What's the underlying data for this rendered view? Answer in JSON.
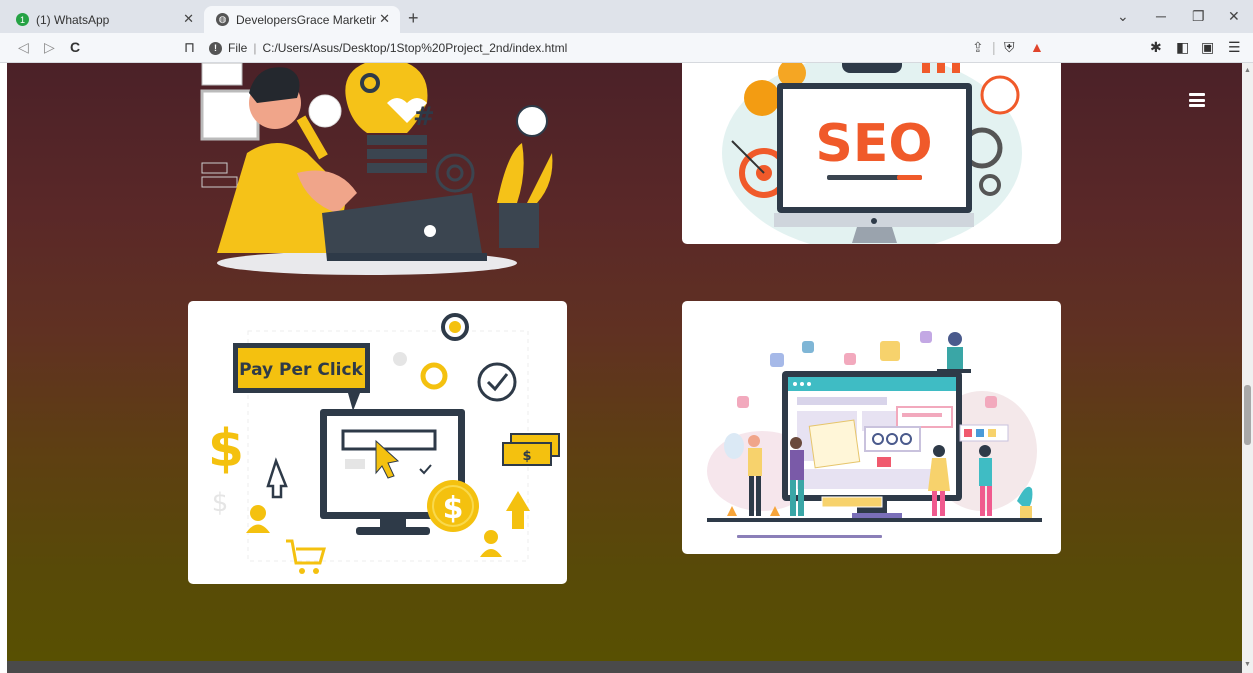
{
  "browser": {
    "tabs": [
      {
        "title": "(1) WhatsApp",
        "favicon": "whatsapp-icon",
        "badge": "1"
      },
      {
        "title": "DevelopersGrace Marketing and",
        "favicon": "globe-icon"
      }
    ],
    "new_tab_label": "+",
    "address": {
      "scheme_label": "File",
      "url": "C:/Users/Asus/Desktop/1Stop%20Project_2nd/index.html"
    },
    "window_controls": [
      "chevron-down-icon",
      "minimize-icon",
      "restore-icon",
      "close-icon"
    ]
  },
  "page": {
    "menu_icon": "hamburger-icon",
    "cards": [
      {
        "id": "social-media",
        "image": "social-media-marketing-illustration"
      },
      {
        "id": "seo",
        "image": "seo-illustration",
        "text": "SEO"
      },
      {
        "id": "ppc",
        "image": "pay-per-click-illustration",
        "text": "Pay Per Click"
      },
      {
        "id": "web-dev",
        "image": "web-development-illustration"
      }
    ]
  },
  "colors": {
    "gradient_top": "#4b2128",
    "gradient_bottom": "#585002",
    "seo_orange": "#f05a2a",
    "ppc_yellow": "#f4c10f",
    "dark_navy": "#2e3a48"
  }
}
